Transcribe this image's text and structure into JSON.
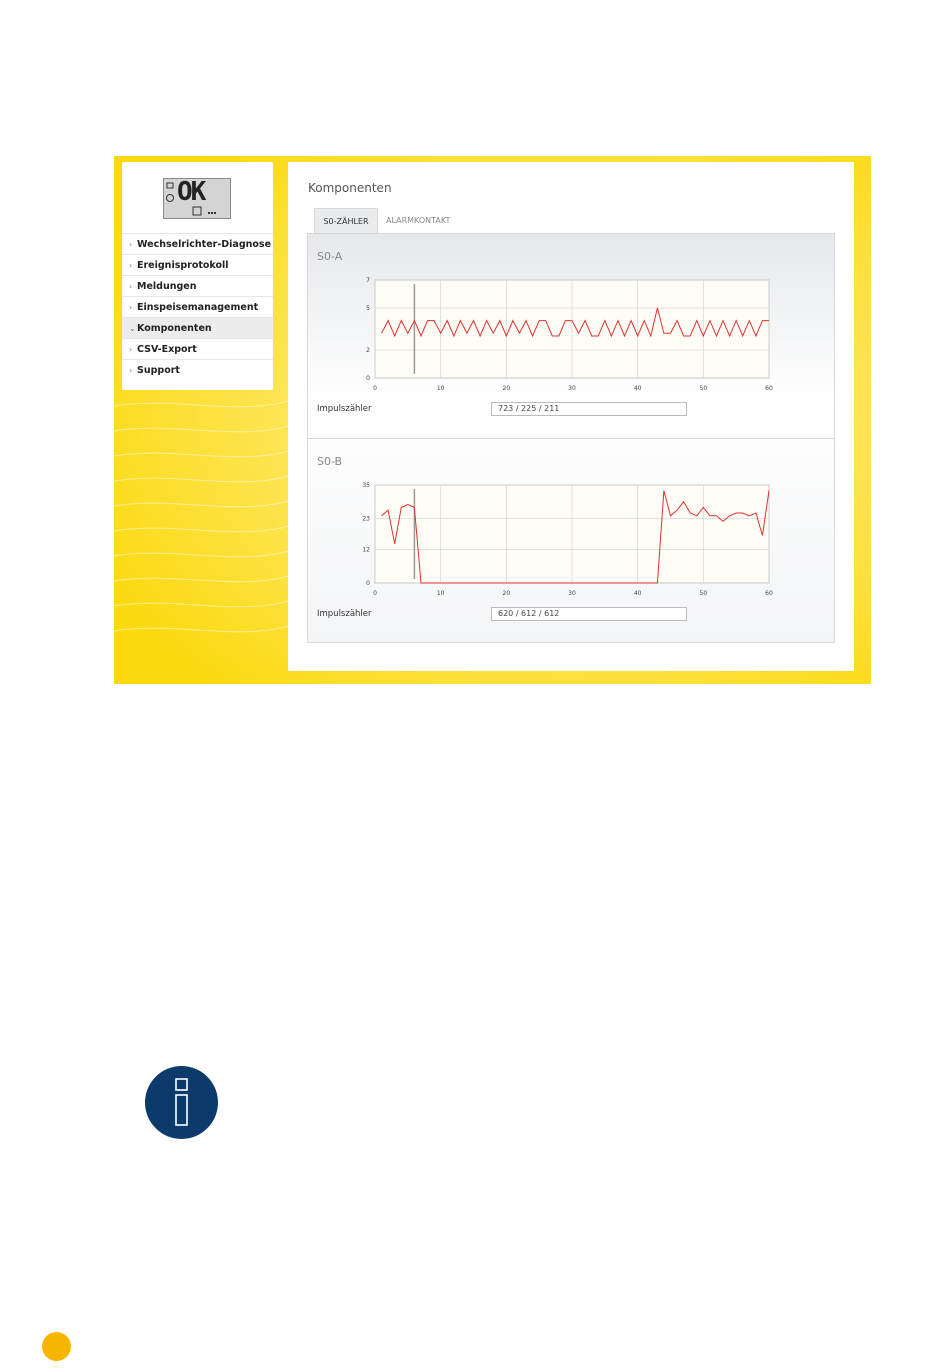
{
  "device_display": {
    "text": "OK"
  },
  "sidebar": {
    "items": [
      {
        "label": "Wechselrichter-Diagnose",
        "chevron": "›",
        "active": false
      },
      {
        "label": "Ereignisprotokoll",
        "chevron": "›",
        "active": false
      },
      {
        "label": "Meldungen",
        "chevron": "›",
        "active": false
      },
      {
        "label": "Einspeisemanagement",
        "chevron": "›",
        "active": false
      },
      {
        "label": "Komponenten",
        "chevron": "⌄",
        "active": true
      },
      {
        "label": "CSV-Export",
        "chevron": "›",
        "active": false
      },
      {
        "label": "Support",
        "chevron": "›",
        "active": false
      }
    ]
  },
  "main": {
    "title": "Komponenten",
    "tabs": [
      {
        "label": "S0-ZÄHLER",
        "active": true
      },
      {
        "label": "ALARMKONTAKT",
        "active": false
      }
    ],
    "sections": [
      {
        "title": "S0-A",
        "field_label": "Impulszähler",
        "field_value": "723 / 225 / 211"
      },
      {
        "title": "S0-B",
        "field_label": "Impulszähler",
        "field_value": "620 / 612 / 612"
      }
    ]
  },
  "colors": {
    "frame": "#fbd90e",
    "line": "#e0312e",
    "info": "#0b3a6b",
    "page_dot": "#f7b500"
  },
  "icons": {
    "info": "info-icon"
  },
  "chart_data": [
    {
      "type": "line",
      "title": "S0-A",
      "xlim": [
        0,
        60
      ],
      "ylim": [
        0,
        7
      ],
      "xticks": [
        0,
        10,
        20,
        30,
        40,
        50,
        60
      ],
      "yticks": [
        0,
        2,
        5,
        7
      ],
      "marker_x": 6,
      "grid": true,
      "series": [
        {
          "x": [
            1,
            2,
            3,
            4,
            5,
            6,
            7,
            8,
            9,
            10,
            11,
            12,
            13,
            14,
            15,
            16,
            17,
            18,
            19,
            20,
            21,
            22,
            23,
            24,
            25,
            26,
            27,
            28,
            29,
            30,
            31,
            32,
            33,
            34,
            35,
            36,
            37,
            38,
            39,
            40,
            41,
            42,
            43,
            44,
            45,
            46,
            47,
            48,
            49,
            50,
            51,
            52,
            53,
            54,
            55,
            56,
            57,
            58,
            59,
            60
          ],
          "y": [
            3.2,
            4.1,
            3.0,
            4.1,
            3.2,
            4.1,
            3.0,
            4.1,
            4.1,
            3.2,
            4.1,
            3.0,
            4.1,
            3.2,
            4.1,
            3.0,
            4.1,
            3.2,
            4.1,
            3.0,
            4.1,
            3.2,
            4.1,
            3.0,
            4.1,
            4.1,
            3.0,
            3.0,
            4.1,
            4.1,
            3.2,
            4.1,
            3.0,
            3.0,
            4.1,
            3.0,
            4.1,
            3.0,
            4.1,
            3.0,
            4.1,
            3.0,
            5.0,
            3.2,
            3.2,
            4.1,
            3.0,
            3.0,
            4.1,
            3.0,
            4.1,
            3.0,
            4.1,
            3.0,
            4.1,
            3.0,
            4.1,
            3.0,
            4.1,
            4.1
          ]
        }
      ]
    },
    {
      "type": "line",
      "title": "S0-B",
      "xlim": [
        0,
        60
      ],
      "ylim": [
        0,
        35
      ],
      "xticks": [
        0,
        10,
        20,
        30,
        40,
        50,
        60
      ],
      "yticks": [
        0,
        12,
        23,
        35
      ],
      "marker_x": 6,
      "grid": true,
      "series": [
        {
          "x": [
            1,
            2,
            3,
            4,
            5,
            6,
            7,
            8,
            9,
            10,
            11,
            12,
            13,
            14,
            15,
            16,
            17,
            18,
            19,
            20,
            21,
            22,
            23,
            24,
            25,
            26,
            27,
            28,
            29,
            30,
            31,
            32,
            33,
            34,
            35,
            36,
            37,
            38,
            39,
            40,
            41,
            42,
            43,
            44,
            45,
            46,
            47,
            48,
            49,
            50,
            51,
            52,
            53,
            54,
            55,
            56,
            57,
            58,
            59,
            60
          ],
          "y": [
            24,
            26,
            14,
            27,
            28,
            27,
            0,
            0,
            0,
            0,
            0,
            0,
            0,
            0,
            0,
            0,
            0,
            0,
            0,
            0,
            0,
            0,
            0,
            0,
            0,
            0,
            0,
            0,
            0,
            0,
            0,
            0,
            0,
            0,
            0,
            0,
            0,
            0,
            0,
            0,
            0,
            0,
            0,
            33,
            24,
            26,
            29,
            25,
            24,
            27,
            24,
            24,
            22,
            24,
            25,
            25,
            24,
            25,
            17,
            33
          ]
        }
      ]
    }
  ]
}
